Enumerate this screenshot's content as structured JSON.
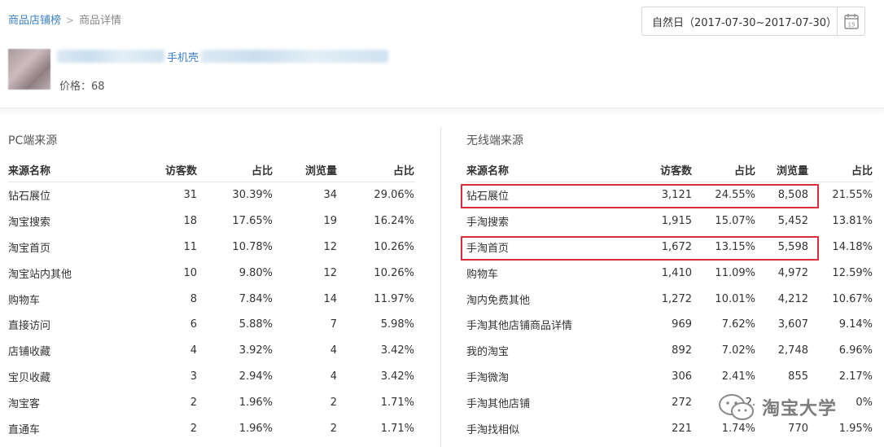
{
  "breadcrumb": {
    "root": "商品店铺榜",
    "separator": ">",
    "current": "商品详情"
  },
  "date_picker": {
    "label": "自然日（2017-07-30~2017-07-30）",
    "icon": "calendar-icon",
    "icon_day": "15"
  },
  "product": {
    "title": "手机壳",
    "price": "价格：68"
  },
  "pc": {
    "title": "PC端来源",
    "headers": [
      "来源名称",
      "访客数",
      "占比",
      "浏览量",
      "占比"
    ],
    "rows": [
      [
        "钻石展位",
        "31",
        "30.39%",
        "34",
        "29.06%"
      ],
      [
        "淘宝搜索",
        "18",
        "17.65%",
        "19",
        "16.24%"
      ],
      [
        "淘宝首页",
        "11",
        "10.78%",
        "12",
        "10.26%"
      ],
      [
        "淘宝站内其他",
        "10",
        "9.80%",
        "12",
        "10.26%"
      ],
      [
        "购物车",
        "8",
        "7.84%",
        "14",
        "11.97%"
      ],
      [
        "直接访问",
        "6",
        "5.88%",
        "7",
        "5.98%"
      ],
      [
        "店铺收藏",
        "4",
        "3.92%",
        "4",
        "3.42%"
      ],
      [
        "宝贝收藏",
        "3",
        "2.94%",
        "4",
        "3.42%"
      ],
      [
        "淘宝客",
        "2",
        "1.96%",
        "2",
        "1.71%"
      ],
      [
        "直通车",
        "2",
        "1.96%",
        "2",
        "1.71%"
      ]
    ]
  },
  "mobile": {
    "title": "无线端来源",
    "headers": [
      "来源名称",
      "访客数",
      "占比",
      "浏览量",
      "占比"
    ],
    "rows": [
      [
        "钻石展位",
        "3,121",
        "24.55%",
        "8,508",
        "21.55%"
      ],
      [
        "手淘搜索",
        "1,915",
        "15.07%",
        "5,452",
        "13.81%"
      ],
      [
        "手淘首页",
        "1,672",
        "13.15%",
        "5,598",
        "14.18%"
      ],
      [
        "购物车",
        "1,410",
        "11.09%",
        "4,972",
        "12.59%"
      ],
      [
        "淘内免费其他",
        "1,272",
        "10.01%",
        "4,212",
        "10.67%"
      ],
      [
        "手淘其他店铺商品详情",
        "969",
        "7.62%",
        "3,607",
        "9.14%"
      ],
      [
        "我的淘宝",
        "892",
        "7.02%",
        "2,748",
        "6.96%"
      ],
      [
        "手淘微淘",
        "306",
        "2.41%",
        "855",
        "2.17%"
      ],
      [
        "手淘其他店铺",
        "272",
        "2.",
        "",
        "0%"
      ],
      [
        "手淘找相似",
        "221",
        "1.74%",
        "770",
        "1.95%"
      ]
    ]
  },
  "watermark": {
    "text": "淘宝大学",
    "icon": "wechat-icon"
  },
  "colors": {
    "link": "#3a7fc6",
    "highlight": "#d9323a",
    "border": "#e6e6e6"
  }
}
